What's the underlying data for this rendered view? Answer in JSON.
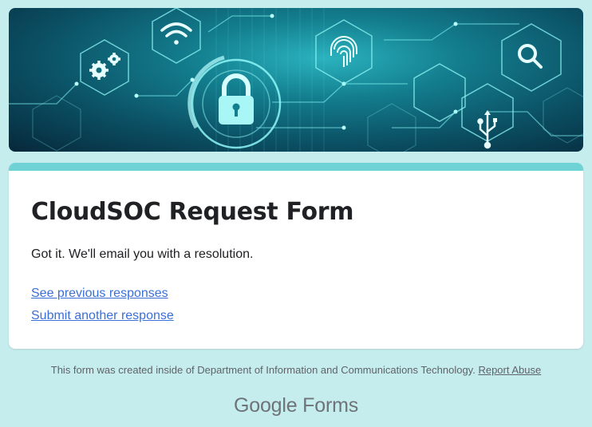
{
  "banner": {
    "colors": {
      "glow": "#2bb3bf",
      "dark": "#06283a",
      "line": "#7ff3f3"
    },
    "icons": [
      "gears-icon",
      "wifi-icon",
      "lock-icon",
      "fingerprint-icon",
      "search-icon",
      "usb-icon"
    ]
  },
  "form": {
    "title": "CloudSOC Request Form",
    "confirmation": "Got it. We'll email you with a resolution.",
    "links": {
      "previous": "See previous responses",
      "another": "Submit another response"
    },
    "accent_color": "#6fd3d6",
    "link_color": "#3b6fd8"
  },
  "footer": {
    "notice": "This form was created inside of Department of Information and Communications Technology.",
    "report": "Report Abuse",
    "brand_google": "Google",
    "brand_forms": "Forms"
  }
}
